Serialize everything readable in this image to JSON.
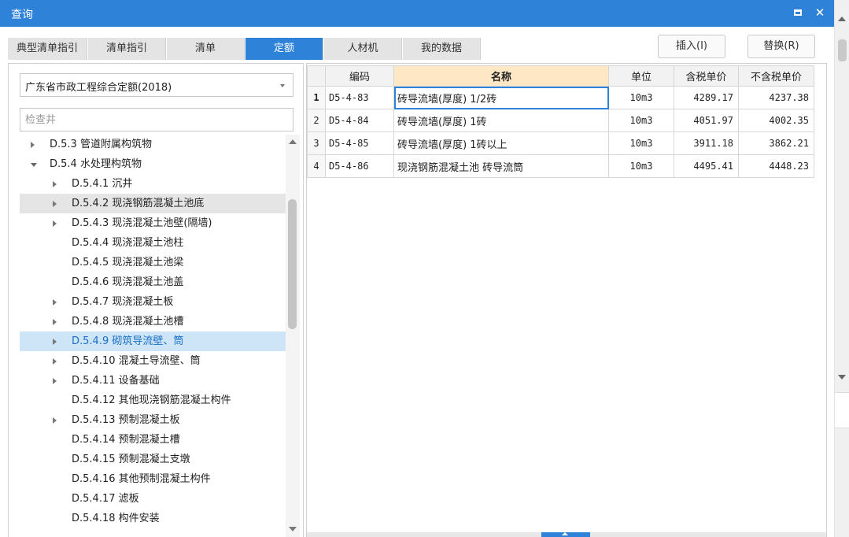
{
  "window": {
    "title": "查询"
  },
  "tabs": [
    {
      "label": "典型清单指引",
      "active": false
    },
    {
      "label": "清单指引",
      "active": false
    },
    {
      "label": "清单",
      "active": false
    },
    {
      "label": "定额",
      "active": true
    },
    {
      "label": "人材机",
      "active": false
    },
    {
      "label": "我的数据",
      "active": false
    }
  ],
  "actions": {
    "insert": "插入(I)",
    "replace": "替换(R)"
  },
  "left": {
    "library": "广东省市政工程综合定额(2018)",
    "search_placeholder": "检查井",
    "tree": [
      {
        "label": "D.5.3 管道附属构筑物",
        "level": 1,
        "arrow": "right"
      },
      {
        "label": "D.5.4 水处理构筑物",
        "level": 1,
        "arrow": "down"
      },
      {
        "label": "D.5.4.1 沉井",
        "level": 2,
        "arrow": "right"
      },
      {
        "label": "D.5.4.2 现浇钢筋混凝土池底",
        "level": 2,
        "arrow": "right",
        "state": "hover"
      },
      {
        "label": "D.5.4.3 现浇混凝土池壁(隔墙)",
        "level": 2,
        "arrow": "right"
      },
      {
        "label": "D.5.4.4 现浇混凝土池柱",
        "level": 2,
        "arrow": ""
      },
      {
        "label": "D.5.4.5 现浇混凝土池梁",
        "level": 2,
        "arrow": ""
      },
      {
        "label": "D.5.4.6 现浇混凝土池盖",
        "level": 2,
        "arrow": ""
      },
      {
        "label": "D.5.4.7 现浇混凝土板",
        "level": 2,
        "arrow": "right"
      },
      {
        "label": "D.5.4.8 现浇混凝土池槽",
        "level": 2,
        "arrow": "right"
      },
      {
        "label": "D.5.4.9 砌筑导流壁、筒",
        "level": 2,
        "arrow": "right",
        "state": "selected"
      },
      {
        "label": "D.5.4.10 混凝土导流壁、筒",
        "level": 2,
        "arrow": "right"
      },
      {
        "label": "D.5.4.11 设备基础",
        "level": 2,
        "arrow": "right"
      },
      {
        "label": "D.5.4.12 其他现浇钢筋混凝土构件",
        "level": 2,
        "arrow": ""
      },
      {
        "label": "D.5.4.13 预制混凝土板",
        "level": 2,
        "arrow": "right"
      },
      {
        "label": "D.5.4.14 预制混凝土槽",
        "level": 2,
        "arrow": ""
      },
      {
        "label": "D.5.4.15 预制混凝土支墩",
        "level": 2,
        "arrow": ""
      },
      {
        "label": "D.5.4.16 其他预制混凝土构件",
        "level": 2,
        "arrow": ""
      },
      {
        "label": "D.5.4.17 滤板",
        "level": 2,
        "arrow": ""
      },
      {
        "label": "D.5.4.18 构件安装",
        "level": 2,
        "arrow": ""
      }
    ]
  },
  "grid": {
    "headers": {
      "code": "编码",
      "name": "名称",
      "unit": "单位",
      "tax_price": "含税单价",
      "notax_price": "不含税单价"
    },
    "rows": [
      {
        "no": "1",
        "code": "D5-4-83",
        "name": "砖导流墙(厚度) 1/2砖",
        "unit": "10m3",
        "tax_price": "4289.17",
        "notax_price": "4237.38"
      },
      {
        "no": "2",
        "code": "D5-4-84",
        "name": "砖导流墙(厚度) 1砖",
        "unit": "10m3",
        "tax_price": "4051.97",
        "notax_price": "4002.35"
      },
      {
        "no": "3",
        "code": "D5-4-85",
        "name": "砖导流墙(厚度) 1砖以上",
        "unit": "10m3",
        "tax_price": "3911.18",
        "notax_price": "3862.21"
      },
      {
        "no": "4",
        "code": "D5-4-86",
        "name": "现浇钢筋混凝土池 砖导流筒",
        "unit": "10m3",
        "tax_price": "4495.41",
        "notax_price": "4448.23"
      }
    ]
  }
}
